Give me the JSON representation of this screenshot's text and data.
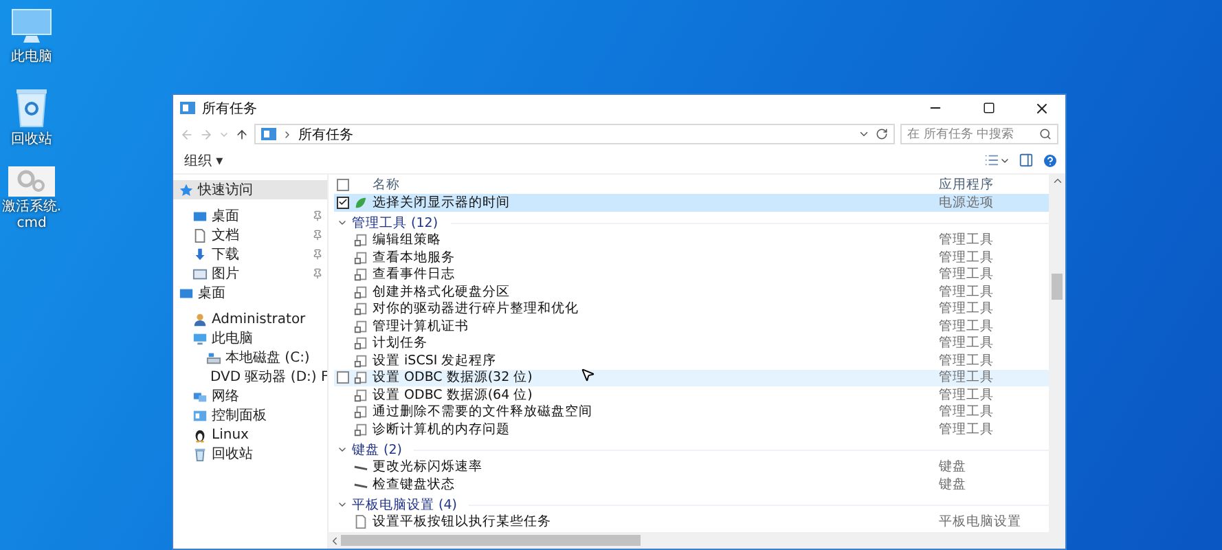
{
  "desktop_icons": [
    {
      "label": "此电脑",
      "kind": "pc"
    },
    {
      "label": "回收站",
      "kind": "recycle"
    },
    {
      "label": "激活系统.cmd",
      "kind": "cmd"
    }
  ],
  "window": {
    "title": "所有任务"
  },
  "address": {
    "path": "所有任务"
  },
  "search": {
    "placeholder": "在 所有任务 中搜索"
  },
  "toolbar": {
    "organize": "组织 ▾"
  },
  "columns": [
    "名称",
    "应用程序"
  ],
  "select_all": {
    "checked": false
  },
  "sidebar": [
    {
      "label": "快速访问",
      "kind": "quick",
      "selected": true,
      "children": [
        {
          "label": "桌面",
          "kind": "desktop",
          "selected": false,
          "pinned": true
        },
        {
          "label": "文档",
          "kind": "docs",
          "selected": false,
          "pinned": true
        },
        {
          "label": "下载",
          "kind": "downloads",
          "selected": false,
          "pinned": true
        },
        {
          "label": "图片",
          "kind": "pictures",
          "selected": false,
          "pinned": true
        }
      ]
    },
    {
      "label": "桌面",
      "kind": "desktop",
      "selected": false,
      "children": [
        {
          "label": "Administrator",
          "kind": "user",
          "selected": false
        },
        {
          "label": "此电脑",
          "kind": "pc",
          "selected": false,
          "children": [
            {
              "label": "本地磁盘 (C:)",
              "kind": "drive",
              "selected": false
            },
            {
              "label": "DVD 驱动器 (D:) F",
              "kind": "dvd",
              "selected": false
            }
          ]
        },
        {
          "label": "网络",
          "kind": "network",
          "selected": false
        },
        {
          "label": "控制面板",
          "kind": "control",
          "selected": false
        },
        {
          "label": "Linux",
          "kind": "linux",
          "selected": false
        },
        {
          "label": "回收站",
          "kind": "recycle",
          "selected": false
        }
      ]
    }
  ],
  "rows": [
    {
      "name": "选择关闭显示器的时间",
      "app": "电源选项",
      "kind": "power",
      "selected": true,
      "checked": true,
      "hovered": false
    }
  ],
  "groups": [
    {
      "title": "管理工具 (12)",
      "expanded": true,
      "rows": [
        {
          "name": "编辑组策略",
          "app": "管理工具",
          "kind": "tool",
          "selected": false,
          "checked": false,
          "hovered": false
        },
        {
          "name": "查看本地服务",
          "app": "管理工具",
          "kind": "tool",
          "selected": false,
          "checked": false,
          "hovered": false
        },
        {
          "name": "查看事件日志",
          "app": "管理工具",
          "kind": "tool",
          "selected": false,
          "checked": false,
          "hovered": false
        },
        {
          "name": "创建并格式化硬盘分区",
          "app": "管理工具",
          "kind": "tool",
          "selected": false,
          "checked": false,
          "hovered": false
        },
        {
          "name": "对你的驱动器进行碎片整理和优化",
          "app": "管理工具",
          "kind": "tool",
          "selected": false,
          "checked": false,
          "hovered": false
        },
        {
          "name": "管理计算机证书",
          "app": "管理工具",
          "kind": "tool",
          "selected": false,
          "checked": false,
          "hovered": false
        },
        {
          "name": "计划任务",
          "app": "管理工具",
          "kind": "tool",
          "selected": false,
          "checked": false,
          "hovered": false
        },
        {
          "name": "设置 iSCSI 发起程序",
          "app": "管理工具",
          "kind": "tool",
          "selected": false,
          "checked": false,
          "hovered": false
        },
        {
          "name": "设置 ODBC 数据源(32 位)",
          "app": "管理工具",
          "kind": "tool",
          "selected": false,
          "checked": false,
          "hovered": true
        },
        {
          "name": "设置 ODBC 数据源(64 位)",
          "app": "管理工具",
          "kind": "tool",
          "selected": false,
          "checked": false,
          "hovered": false
        },
        {
          "name": "通过删除不需要的文件释放磁盘空间",
          "app": "管理工具",
          "kind": "tool",
          "selected": false,
          "checked": false,
          "hovered": false
        },
        {
          "name": "诊断计算机的内存问题",
          "app": "管理工具",
          "kind": "tool",
          "selected": false,
          "checked": false,
          "hovered": false
        }
      ]
    },
    {
      "title": "键盘 (2)",
      "expanded": true,
      "rows": [
        {
          "name": "更改光标闪烁速率",
          "app": "键盘",
          "kind": "keyboard",
          "selected": false,
          "checked": false,
          "hovered": false
        },
        {
          "name": "检查键盘状态",
          "app": "键盘",
          "kind": "keyboard",
          "selected": false,
          "checked": false,
          "hovered": false
        }
      ]
    },
    {
      "title": "平板电脑设置 (4)",
      "expanded": true,
      "rows": [
        {
          "name": "设置平板按钮以执行某些任务",
          "app": "平板电脑设置",
          "kind": "tablet",
          "selected": false,
          "checked": false,
          "hovered": false
        }
      ]
    }
  ]
}
